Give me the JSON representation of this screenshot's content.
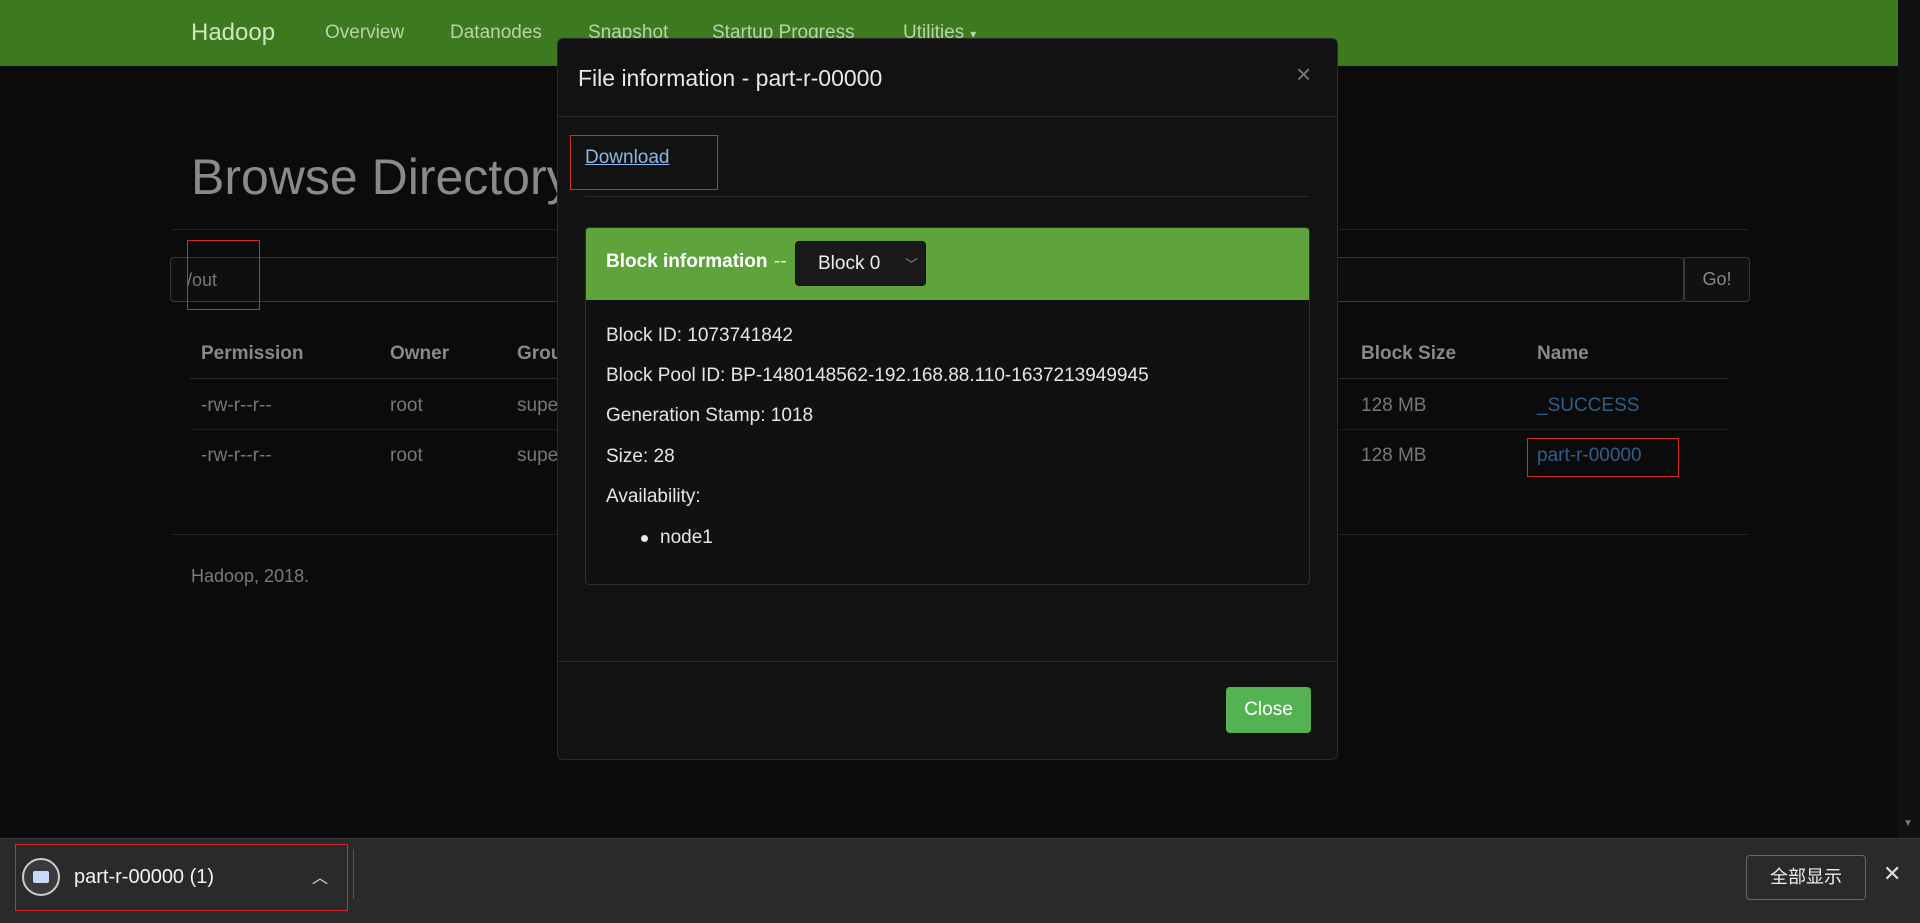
{
  "navbar": {
    "brand": "Hadoop",
    "items": [
      "Overview",
      "Datanodes",
      "Snapshot",
      "Startup Progress",
      "Utilities"
    ],
    "utilities_caret": "▾"
  },
  "browse": {
    "title": "Browse Directory",
    "path_value": "/out",
    "go_label": "Go!",
    "columns": [
      "Permission",
      "Owner",
      "Group",
      "Block Size",
      "Name"
    ],
    "rows": [
      {
        "permission": "-rw-r--r--",
        "owner": "root",
        "group": "supe",
        "block_size": "128 MB",
        "name": "_SUCCESS"
      },
      {
        "permission": "-rw-r--r--",
        "owner": "root",
        "group": "supe",
        "block_size": "128 MB",
        "name": "part-r-00000"
      }
    ],
    "footer": "Hadoop, 2018."
  },
  "modal": {
    "title": "File information - part-r-00000",
    "close_x": "×",
    "download_label": "Download",
    "block_header_label": "Block information",
    "block_header_dash": "--",
    "block_selected": "Block 0",
    "block_id": "Block ID: 1073741842",
    "block_pool_id": "Block Pool ID: BP-1480148562-192.168.88.110-1637213949945",
    "generation_stamp": "Generation Stamp: 1018",
    "size": "Size: 28",
    "availability_label": "Availability:",
    "availability_nodes": [
      "node1"
    ],
    "close_label": "Close"
  },
  "download_bar": {
    "file_name": "part-r-00000 (1)",
    "show_all_label": "全部显示",
    "close_glyph": "✕"
  },
  "colors": {
    "navbar_green": "#3d7a1f",
    "panel_green": "#5fa33d",
    "close_button_green": "#55b253",
    "link_blue": "#8ab9ee",
    "highlight_red": "#d42a2a"
  }
}
